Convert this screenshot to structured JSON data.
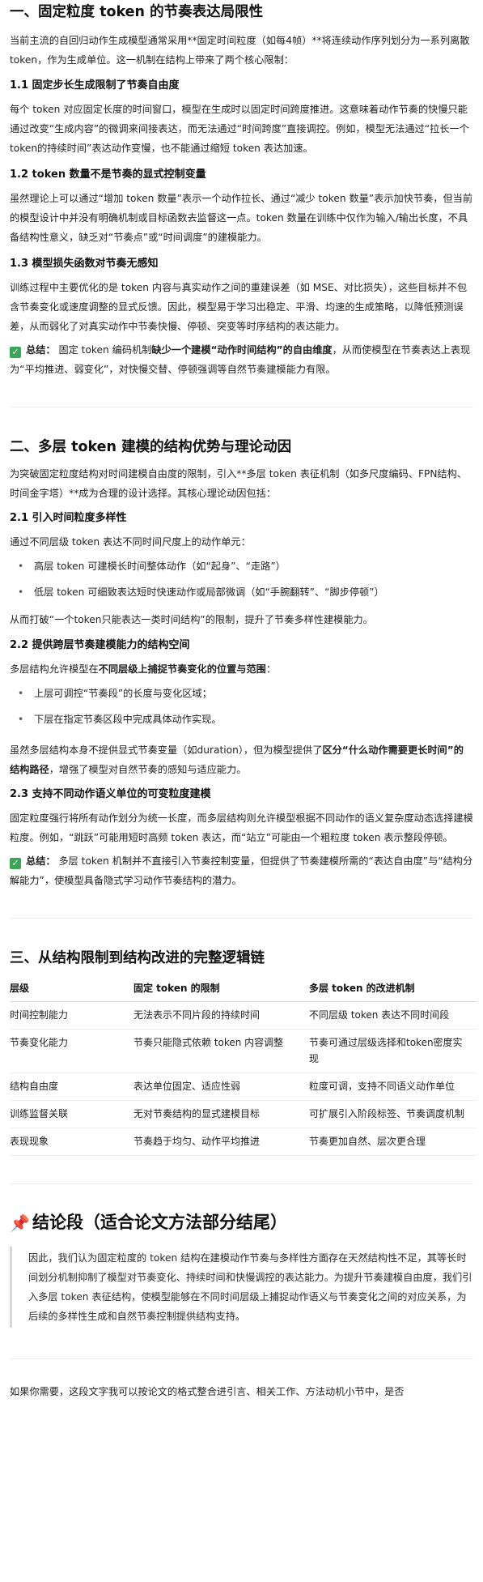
{
  "s1": {
    "title": "一、固定粒度 token 的节奏表达局限性",
    "intro": "当前主流的自回归动作生成模型通常采用**固定时间粒度（如每4帧）**将连续动作序列划分为一系列离散 token，作为生成单位。这一机制在结构上带来了两个核心限制：",
    "h11": "1.1 固定步长生成限制了节奏自由度",
    "p11": "每个 token 对应固定长度的时间窗口，模型在生成时以固定时间跨度推进。这意味着动作节奏的快慢只能通过改变“生成内容”的微调来间接表达，而无法通过“时间跨度”直接调控。例如，模型无法通过“拉长一个token的持续时间”表达动作变慢，也不能通过缩短 token 表达加速。",
    "h12": "1.2 token 数量不是节奏的显式控制变量",
    "p12": "虽然理论上可以通过“增加 token 数量”表示一个动作拉长、通过“减少 token 数量”表示加快节奏，但当前的模型设计中并没有明确机制或目标函数去监督这一点。token 数量在训练中仅作为输入/输出长度，不具备结构性意义，缺乏对“节奏点”或“时间调度”的建模能力。",
    "h13": "1.3 模型损失函数对节奏无感知",
    "p13": "训练过程中主要优化的是 token 内容与真实动作之间的重建误差（如 MSE、对比损失），这些目标并不包含节奏变化或速度调整的显式反馈。因此，模型易于学习出稳定、平滑、均速的生成策略，以降低预测误差，从而弱化了对真实动作中节奏快慢、停顿、突变等时序结构的表达能力。",
    "sum_label": "总结：",
    "sum_a": "固定 token 编码机制",
    "sum_b": "缺少一个建模“动作时间结构”的自由维度",
    "sum_c": "，从而使模型在节奏表达上表现为“平均推进、弱变化”，对快慢交替、停顿强调等自然节奏建模能力有限。"
  },
  "s2": {
    "title": "二、多层 token 建模的结构优势与理论动因",
    "intro": "为突破固定粒度结构对时间建模自由度的限制，引入**多层 token 表征机制（如多尺度编码、FPN结构、时间金字塔）**成为合理的设计选择。其核心理论动因包括：",
    "h21": "2.1 引入时间粒度多样性",
    "p21": "通过不同层级 token 表达不同时间尺度上的动作单元：",
    "li21": [
      "高层 token 可建模长时间整体动作（如“起身”、“走路”）",
      "低层 token 可细致表达短时快速动作或局部微调（如“手腕翻转”、“脚步停顿”）"
    ],
    "p21b": "从而打破“一个token只能表达一类时间结构”的限制，提升了节奏多样性建模能力。",
    "h22": "2.2 提供跨层节奏建模能力的结构空间",
    "p22a": "多层结构允许模型在",
    "p22b": "不同层级上捕捉节奏变化的位置与范围",
    "p22c": "：",
    "li22": [
      "上层可调控“节奏段”的长度与变化区域；",
      "下层在指定节奏区段中完成具体动作实现。"
    ],
    "p22d_a": "虽然多层结构本身不提供显式节奏变量（如duration），但为模型提供了",
    "p22d_b": "区分“什么动作需要更长时间”的结构路径",
    "p22d_c": "，增强了模型对自然节奏的感知与适应能力。",
    "h23": "2.3 支持不同动作语义单位的可变粒度建模",
    "p23": "固定粒度强行将所有动作划分为统一长度，而多层结构则允许模型根据不同动作的语义复杂度动态选择建模粒度。例如，“跳跃”可能用短时高频 token 表达，而“站立”可能由一个粗粒度 token 表示整段停顿。",
    "sum_label": "总结：",
    "sum": "多层 token 机制并不直接引入节奏控制变量，但提供了节奏建模所需的“表达自由度”与“结构分解能力”，使模型具备隐式学习动作节奏结构的潜力。"
  },
  "s3": {
    "title": "三、从结构限制到结构改进的完整逻辑链",
    "headers": [
      "层级",
      "固定 token 的限制",
      "多层 token 的改进机制"
    ],
    "rows": [
      [
        "时间控制能力",
        "无法表示不同片段的持续时间",
        "不同层级 token 表达不同时间段"
      ],
      [
        "节奏变化能力",
        "节奏只能隐式依赖 token 内容调整",
        "节奏可通过层级选择和token密度实现"
      ],
      [
        "结构自由度",
        "表达单位固定、适应性弱",
        "粒度可调，支持不同语义动作单位"
      ],
      [
        "训练监督关联",
        "无对节奏结构的显式建模目标",
        "可扩展引入阶段标签、节奏调度机制"
      ],
      [
        "表现现象",
        "节奏趋于均匀、动作平均推进",
        "节奏更加自然、层次更合理"
      ]
    ]
  },
  "s4": {
    "icon": "pushpin-icon",
    "title": "结论段（适合论文方法部分结尾）",
    "quote": "因此，我们认为固定粒度的 token 结构在建模动作节奏与多样性方面存在天然结构性不足，其等长时间划分机制抑制了模型对节奏变化、持续时间和快慢调控的表达能力。为提升节奏建模自由度，我们引入多层 token 表征结构，使模型能够在不同时间层级上捕捉动作语义与节奏变化之间的对应关系，为后续的多样性生成和自然节奏控制提供结构支持。"
  },
  "footer": {
    "text": "如果你需要，这段文字我可以按论文的格式整合进引言、相关工作、方法动机小节中，是否"
  },
  "colors": {
    "check": "#3aa757",
    "pin": "#e8455c"
  }
}
